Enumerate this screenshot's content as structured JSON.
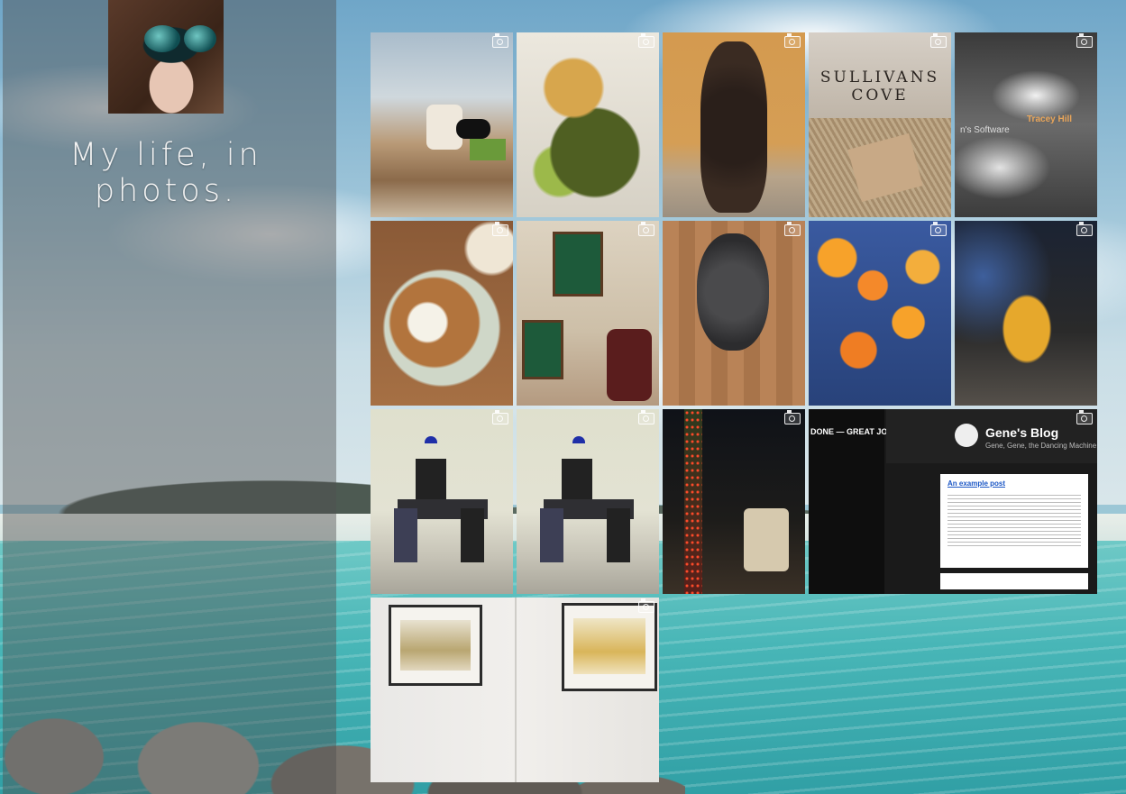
{
  "site": {
    "title": "My life, in photos."
  },
  "icons": {
    "tile_badge": "camera-icon"
  },
  "grid": {
    "photos": [
      {
        "id": "sunroom-chair",
        "description": "sunroom-with-chair-and-cat"
      },
      {
        "id": "roast-potatoes-salad",
        "description": "roast-potatoes-salad"
      },
      {
        "id": "curly-dog-statue",
        "description": "curly-dog-sculpture"
      },
      {
        "id": "sullivans-cove-box",
        "description": "sullivans-cove-whisky-box"
      },
      {
        "id": "clouds-quote",
        "description": "clouds-with-text"
      },
      {
        "id": "pancake-bananas",
        "description": "pancake-with-cream-and-bananas"
      },
      {
        "id": "office-certificates",
        "description": "office-with-certificates"
      },
      {
        "id": "grey-poodle",
        "description": "grey-poodle-sitting"
      },
      {
        "id": "apricots-bowl",
        "description": "bowl-of-apricots"
      },
      {
        "id": "whisky-glass",
        "description": "glass-of-whisky"
      },
      {
        "id": "dining-room-1",
        "description": "dining-room-table-setting"
      },
      {
        "id": "dining-room-2",
        "description": "dining-room-table-setting"
      },
      {
        "id": "christmas-tree",
        "description": "christmas-tree-lights"
      },
      {
        "id": "genes-blog",
        "description": "blog-screenshot"
      },
      {
        "id": "paintings-wall",
        "description": "two-framed-paintings"
      }
    ],
    "sullivans_text": [
      "SULLIVANS",
      "COVE"
    ],
    "clouds_text": "Tracey Hill",
    "clouds_text2": "n's Software",
    "blog": {
      "title": "Gene's Blog",
      "subtitle": "Gene, Gene, the Dancing Machine",
      "post": "An example post",
      "left_banner": "DONE — GREAT JOB!"
    }
  }
}
